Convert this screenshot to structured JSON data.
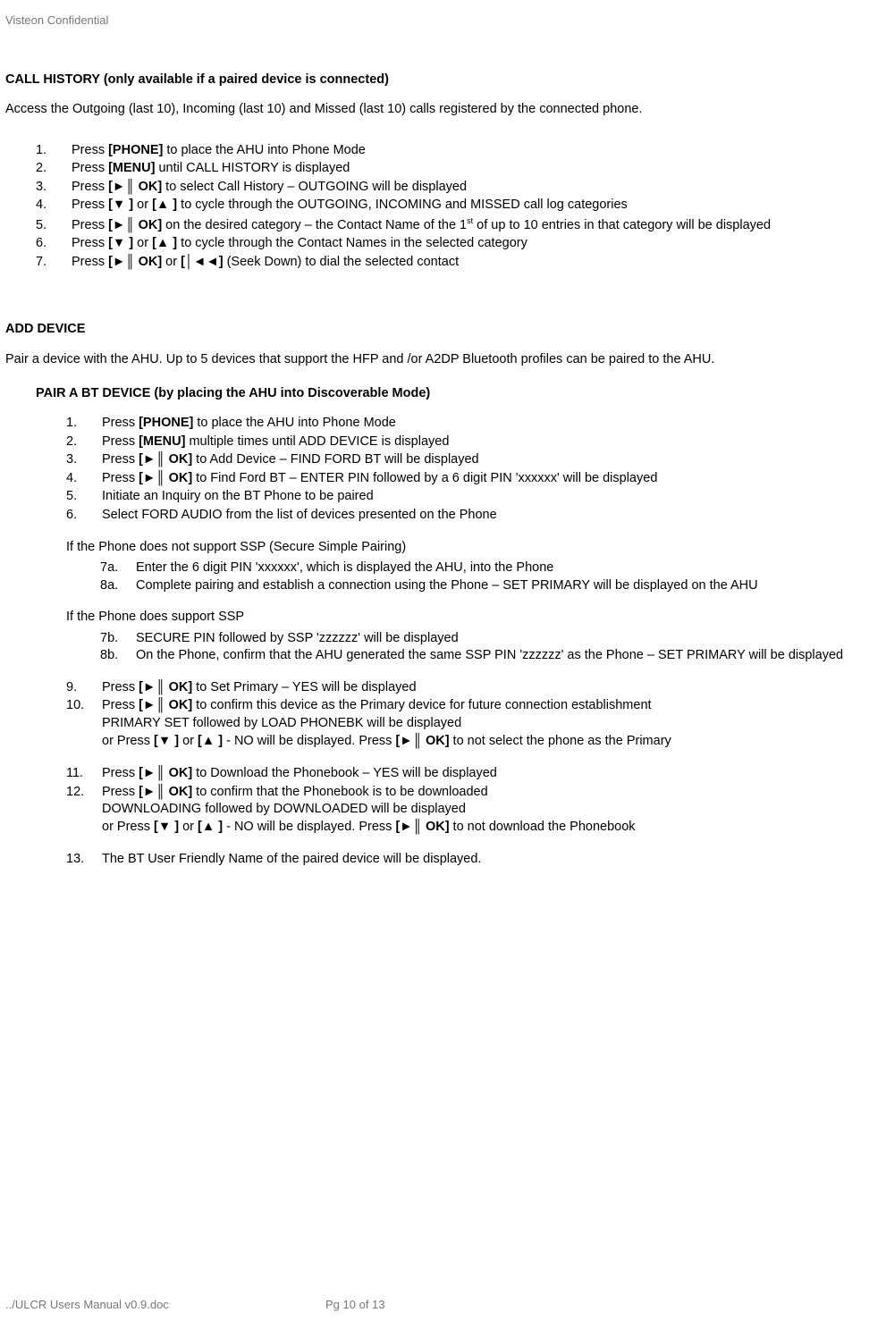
{
  "header": {
    "confidential": "Visteon Confidential"
  },
  "btn": {
    "phone": "[PHONE]",
    "menu": "[MENU]",
    "ok": "[►║ OK]",
    "down": "[▼ ]",
    "up": "[▲ ]",
    "seekdown": "[│◄◄]"
  },
  "callhistory": {
    "title": "CALL HISTORY (only available if a paired device is connected)",
    "intro": "Access the Outgoing (last 10), Incoming (last 10) and Missed (last 10) calls registered by the connected phone.",
    "steps": {
      "s1a": "Press ",
      "s1b": " to place the AHU into Phone Mode",
      "s2a": "Press ",
      "s2b": " until CALL HISTORY is displayed",
      "s3a": "Press ",
      "s3b": " to select Call History – OUTGOING will be displayed",
      "s4a": "Press ",
      "s4b": " or ",
      "s4c": " to cycle through the OUTGOING, INCOMING and MISSED call log categories",
      "s5a": "Press ",
      "s5b": " on the desired category – the Contact Name of the 1",
      "s5sup": "st",
      "s5c": " of up to 10 entries in that category will be displayed",
      "s6a": "Press ",
      "s6b": " or ",
      "s6c": " to cycle through the Contact Names in the selected category",
      "s7a": "Press ",
      "s7b": " or ",
      "s7c": " (Seek Down) to dial the selected contact"
    }
  },
  "adddevice": {
    "title": "ADD DEVICE",
    "intro": "Pair a device with the AHU.  Up to 5 devices that support the HFP and /or A2DP Bluetooth profiles can be paired to the AHU.",
    "subtitle": "PAIR A BT DEVICE (by placing the AHU into Discoverable Mode)",
    "steps": {
      "s1a": "Press ",
      "s1b": " to place the AHU into Phone Mode",
      "s2a": "Press ",
      "s2b": " multiple times until ADD DEVICE is displayed",
      "s3a": "Press ",
      "s3b": " to Add Device – FIND FORD BT will be displayed",
      "s4a": "Press ",
      "s4b": " to Find Ford BT – ENTER PIN followed by a 6 digit PIN 'xxxxxx' will be displayed",
      "s5": "Initiate an Inquiry on the BT Phone to be paired",
      "s6": "Select FORD AUDIO from the list of devices presented on the Phone"
    },
    "nossp": "If the Phone does not support SSP (Secure Simple Pairing)",
    "nossp_steps": {
      "s7a": "Enter the 6 digit PIN 'xxxxxx', which is displayed the AHU, into the Phone",
      "s8a": "Complete pairing and establish a connection using the Phone – SET PRIMARY will be displayed on the AHU"
    },
    "ssp": "If the Phone does support SSP",
    "ssp_steps": {
      "s7b": "SECURE PIN followed by SSP 'zzzzzz' will be displayed",
      "s8b": "On the Phone, confirm that the AHU generated the same SSP PIN 'zzzzzz' as the Phone – SET PRIMARY will be displayed"
    },
    "steps2": {
      "s9a": "Press ",
      "s9b": " to Set Primary – YES will be displayed",
      "s10a": "Press ",
      "s10b": " to confirm this device as the Primary device for future connection establishment",
      "s10line2": "PRIMARY SET followed by LOAD PHONEBK will be displayed",
      "s10line3a": "or Press ",
      "s10line3b": " or ",
      "s10line3c": " - NO will be displayed.  Press ",
      "s10line3d": " to not select the phone as the Primary",
      "s11a": "Press ",
      "s11b": " to Download the Phonebook – YES will be displayed",
      "s12a": "Press ",
      "s12b": " to confirm that the Phonebook is to be downloaded",
      "s12line2": "DOWNLOADING followed by DOWNLOADED will be displayed",
      "s12line3a": "or Press ",
      "s12line3b": " or ",
      "s12line3c": " - NO will be displayed.  Press ",
      "s12line3d": " to not download the Phonebook",
      "s13": "The BT User Friendly Name of the paired device will be displayed."
    }
  },
  "nums": {
    "n1": "1.",
    "n2": "2.",
    "n3": "3.",
    "n4": "4.",
    "n5": "5.",
    "n6": "6.",
    "n7": "7.",
    "n7a": "7a.",
    "n8a": "8a.",
    "n7b": "7b.",
    "n8b": "8b.",
    "n9": "9.",
    "n10": "10.",
    "n11": "11.",
    "n12": "12.",
    "n13": "13."
  },
  "footer": {
    "path": "../ULCR Users Manual v0.9.doc",
    "page": "Pg 10 of 13"
  }
}
